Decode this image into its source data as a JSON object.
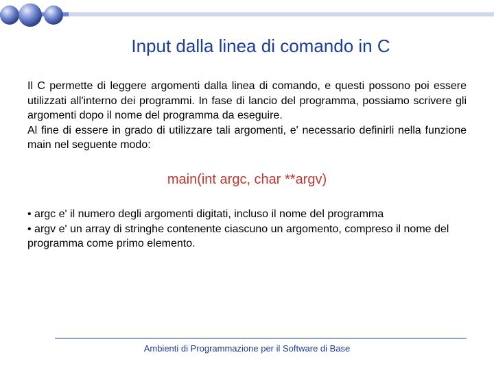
{
  "slide": {
    "title": "Input dalla linea di comando in C",
    "paragraph": "Il C permette di leggere argomenti dalla linea di comando, e questi possono poi essere utilizzati all'interno dei programmi. In fase di lancio del programma, possiamo scrivere gli argomenti dopo il nome del programma da eseguire.\nAl fine di essere in grado di utilizzare tali argomenti, e' necessario definirli nella funzione main nel seguente modo:",
    "code": "main(int argc, char **argv)",
    "bullet1": "• argc e' il numero degli argomenti digitati, incluso il nome del programma",
    "bullet2": "• argv e' un array di stringhe contenente ciascuno un argomento, compreso il nome del programma come primo elemento.",
    "footer": "Ambienti di Programmazione per il Software di Base"
  }
}
